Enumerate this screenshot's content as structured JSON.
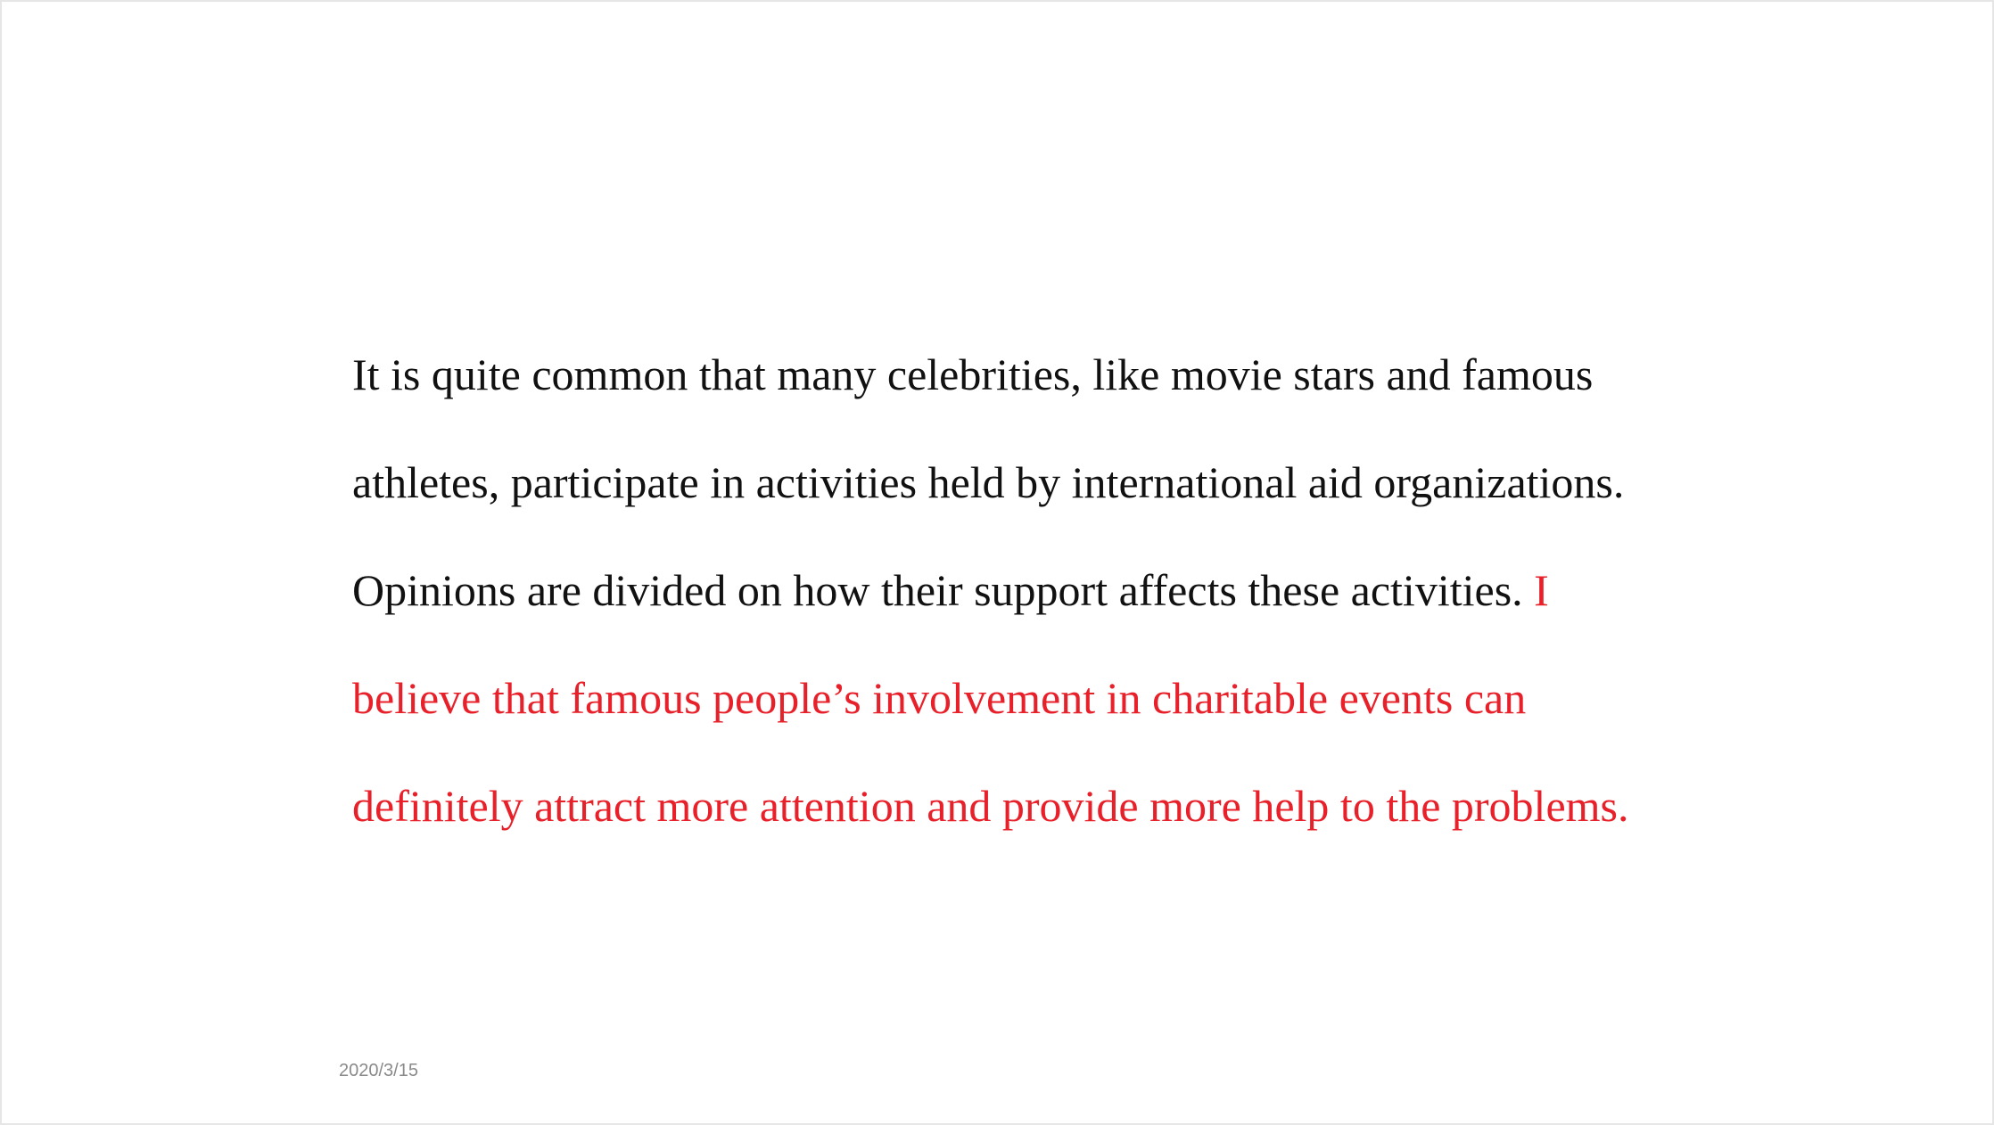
{
  "slide": {
    "lines": [
      {
        "text": "It is quite common that many celebrities, like movie stars and famous"
      },
      {
        "text": "athletes, participate in activities held by international aid organizations."
      },
      {
        "text": "Opinions are divided on how their support affects these activities.",
        "highlight": "I"
      },
      {
        "highlight": "believe that famous people’s involvement in charitable events can"
      },
      {
        "highlight": "definitely attract more attention and provide more help to the problems."
      }
    ],
    "date": "2020/3/15"
  },
  "colors": {
    "text": "#111111",
    "highlight": "#e8202a",
    "date": "#8a8a8a",
    "border": "#e6e6e6"
  }
}
